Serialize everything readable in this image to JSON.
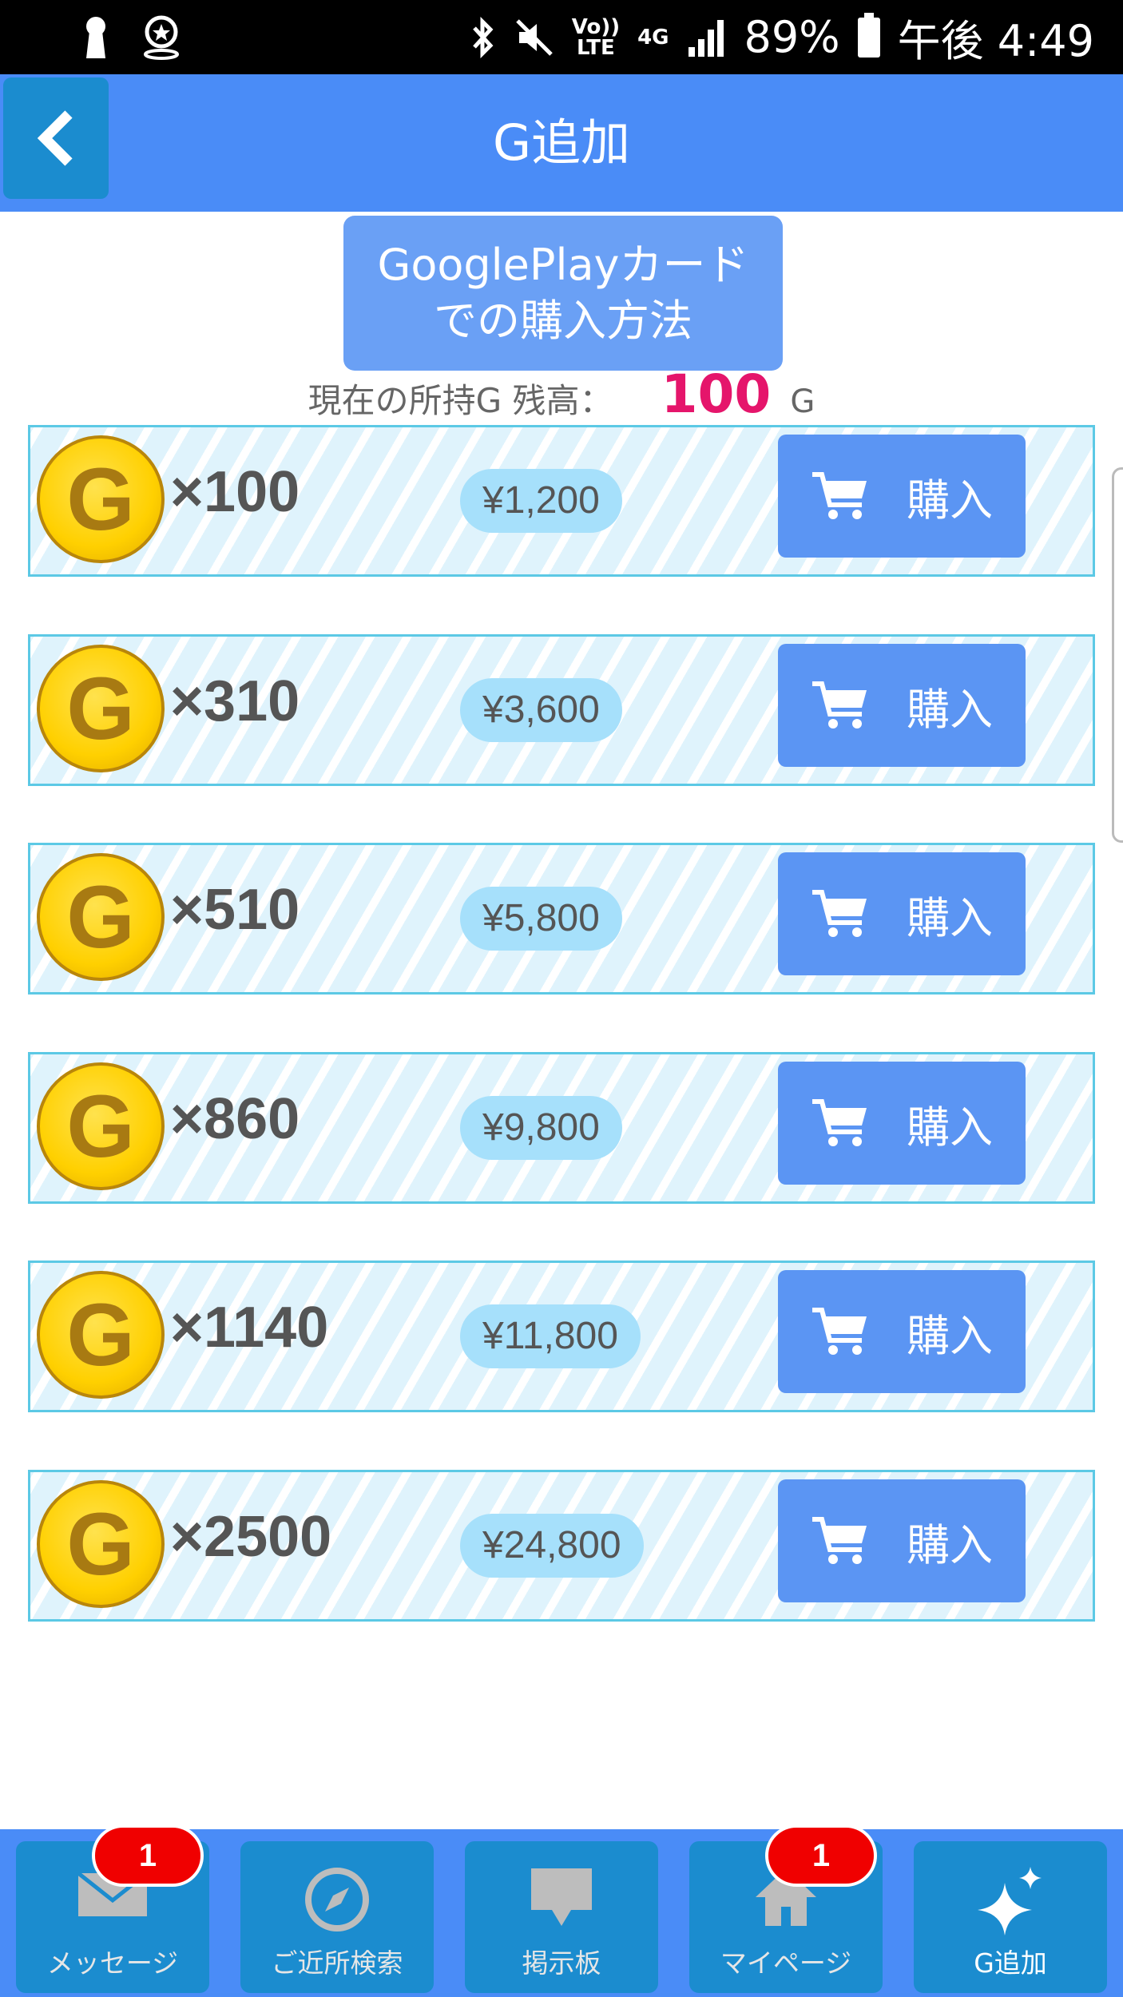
{
  "status_bar": {
    "network_top": "Vo))",
    "network_bottom": "LTE",
    "mobile_type": "4G",
    "battery": "89%",
    "time": "午後 4:49"
  },
  "header": {
    "title": "G追加"
  },
  "guide_button": {
    "line1": "GooglePlayカード",
    "line2": "での購入方法"
  },
  "balance": {
    "label": "現在の所持G 残高：",
    "value": "100",
    "unit": "G"
  },
  "items": [
    {
      "coin": "G",
      "amount": "×100",
      "price": "¥1,200",
      "buy_label": "購入"
    },
    {
      "coin": "G",
      "amount": "×310",
      "price": "¥3,600",
      "buy_label": "購入"
    },
    {
      "coin": "G",
      "amount": "×510",
      "price": "¥5,800",
      "buy_label": "購入"
    },
    {
      "coin": "G",
      "amount": "×860",
      "price": "¥9,800",
      "buy_label": "購入"
    },
    {
      "coin": "G",
      "amount": "×1140",
      "price": "¥11,800",
      "buy_label": "購入"
    },
    {
      "coin": "G",
      "amount": "×2500",
      "price": "¥24,800",
      "buy_label": "購入"
    }
  ],
  "bottom_nav": [
    {
      "label": "メッセージ",
      "icon": "mail-icon",
      "badge": "1"
    },
    {
      "label": "ご近所検索",
      "icon": "compass-icon"
    },
    {
      "label": "掲示板",
      "icon": "chat-bubble-icon"
    },
    {
      "label": "マイページ",
      "icon": "home-icon",
      "badge": "1"
    },
    {
      "label": "G追加",
      "icon": "sparkle-icon"
    }
  ],
  "colors": {
    "header": "#4a8cf7",
    "buy_button": "#5b95f3",
    "balance_value": "#e5156b",
    "badge": "#f00000"
  }
}
